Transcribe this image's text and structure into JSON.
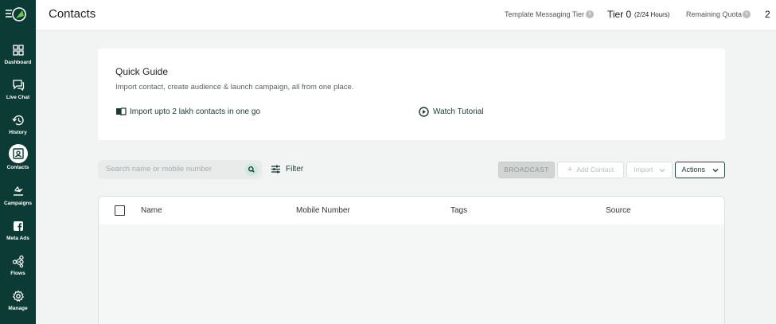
{
  "sidebar": {
    "items": [
      {
        "label": "Dashboard",
        "icon": "dashboard-icon"
      },
      {
        "label": "Live Chat",
        "icon": "chat-icon"
      },
      {
        "label": "History",
        "icon": "history-icon"
      },
      {
        "label": "Contacts",
        "icon": "contacts-icon",
        "active": true
      },
      {
        "label": "Campaigns",
        "icon": "campaigns-icon"
      },
      {
        "label": "Meta Ads",
        "icon": "facebook-icon"
      },
      {
        "label": "Flows",
        "icon": "flows-icon"
      },
      {
        "label": "Manage",
        "icon": "gear-icon"
      }
    ]
  },
  "header": {
    "title": "Contacts",
    "tier_label": "Template Messaging Tier",
    "tier_value": "Tier 0",
    "tier_hours": "(2/24 Hours)",
    "quota_label": "Remaining Quota",
    "quota_value": "2",
    "info_glyph": "i"
  },
  "guide": {
    "title": "Quick Guide",
    "subtitle": "Import contact, create audience & launch campaign, all from one place.",
    "import_link": "Import upto 2 lakh contacts in one go",
    "tutorial_link": "Watch Tutorial"
  },
  "toolbar": {
    "search_placeholder": "Search name or mobile number",
    "filter_label": "Filter",
    "broadcast_label": "BROADCAST",
    "add_contact_label": "Add Contact",
    "import_label": "Import",
    "actions_label": "Actions"
  },
  "table": {
    "columns": [
      "Name",
      "Mobile Number",
      "Tags",
      "Source"
    ]
  },
  "colors": {
    "sidebar_bg": "#0b3b34",
    "accent": "#1c3a35",
    "page_bg": "#f2f3f3"
  }
}
